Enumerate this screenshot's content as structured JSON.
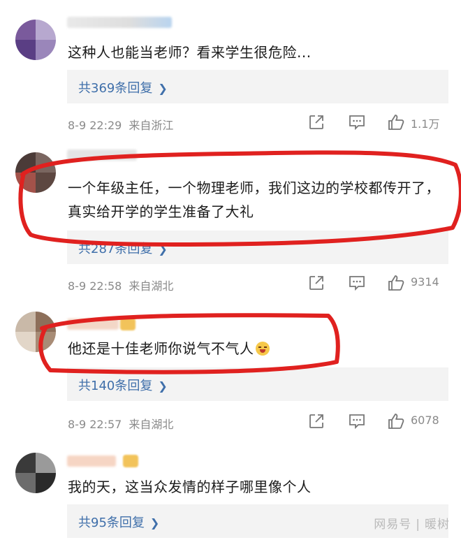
{
  "comments": [
    {
      "text": "这种人也能当老师？看来学生很危险...",
      "reply_label": "共369条回复",
      "date": "8-9 22:29",
      "region": "来自浙江",
      "likes": "1.1万"
    },
    {
      "text": "一个年级主任，一个物理老师，我们这边的学校都传开了，真实给开学的学生准备了大礼",
      "reply_label": "共287条回复",
      "date": "8-9 22:58",
      "region": "来自湖北",
      "likes": "9314"
    },
    {
      "text": "他还是十佳老师你说气不气人",
      "reply_label": "共140条回复",
      "date": "8-9 22:57",
      "region": "来自湖北",
      "likes": "6078"
    },
    {
      "text": "我的天，这当众发情的样子哪里像个人",
      "reply_label": "共95条回复"
    }
  ],
  "watermark": {
    "brand": "网易号",
    "author": "暖树"
  },
  "icons": {
    "share": "share-icon",
    "comment": "comment-icon",
    "like": "thumbs-up-icon",
    "reply_chevron": "chevron-right-icon"
  },
  "colors": {
    "reply_link": "#3f6faa",
    "meta_text": "#8a8a8a",
    "reply_bg": "#f3f3f3",
    "marker": "#e0211f"
  }
}
